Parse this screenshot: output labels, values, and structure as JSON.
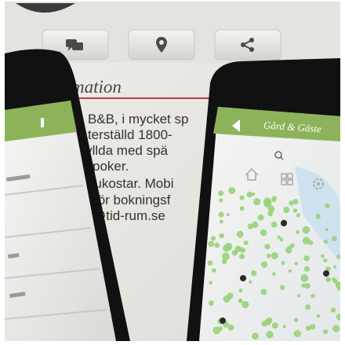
{
  "heading": "mation",
  "text_lines": [
    "z, B&B, i mycket sp",
    "l återställd 1800-",
    "r fyllda med spä",
    "poker.",
    "frukostar. Mobi",
    "för bokningsf",
    "@tid-rum.se"
  ],
  "icons": [
    "chat-icon",
    "location-pin-icon",
    "share-icon",
    "home-icon",
    "grid-icon",
    "gear-icon",
    "back-arrow-icon",
    "search-icon"
  ],
  "right_phone": {
    "title": "Gård & Gäste"
  },
  "colors": {
    "app_green": "#8db35a",
    "accent_red": "#c43a4a",
    "paper": "#e9e8e4",
    "map_green": "#98d27a",
    "water": "#cfe2ef"
  }
}
